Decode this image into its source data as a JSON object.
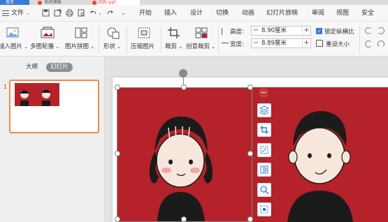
{
  "colors": {
    "accent_orange": "#f08a3c",
    "wps_blue": "#3a7bd5",
    "photo_red": "#b5222a",
    "close_circle": "#c53a3a"
  },
  "titlebar": {
    "tabs": [
      "首页",
      "稻壳模板",
      "润色Ⅰ.ppt"
    ]
  },
  "menu": {
    "file": "文件",
    "tabs": [
      "开始",
      "插入",
      "设计",
      "切换",
      "动画",
      "幻灯片放映",
      "审阅",
      "视图",
      "安全"
    ],
    "quick_access_icons": [
      "save-icon",
      "save-as-icon",
      "print-icon",
      "print-preview-icon",
      "undo-icon",
      "redo-icon",
      "more-icon"
    ]
  },
  "ribbon": {
    "insert_picture": "插入图片",
    "multi_outline": "多图轮播",
    "picture_collage": "图片拼图",
    "shape": "形状",
    "compress": "压缩图片",
    "crop": "裁剪",
    "creative_crop": "创意裁剪",
    "height_label": "高度:",
    "height_value": "8.90厘米",
    "width_label": "宽度:",
    "width_value": "8.89厘米",
    "lock_ratio": "锁定纵横比",
    "reset_size": "重设大小",
    "minus": "−",
    "plus": "+"
  },
  "leftpane": {
    "tab_outline": "大纲",
    "tab_slides": "幻灯片",
    "slide_number": "1"
  },
  "side_tools": [
    "close-icon",
    "layers-icon",
    "crop-icon",
    "crop-square-icon",
    "split-icon",
    "zoom-icon",
    "selection-icon"
  ]
}
